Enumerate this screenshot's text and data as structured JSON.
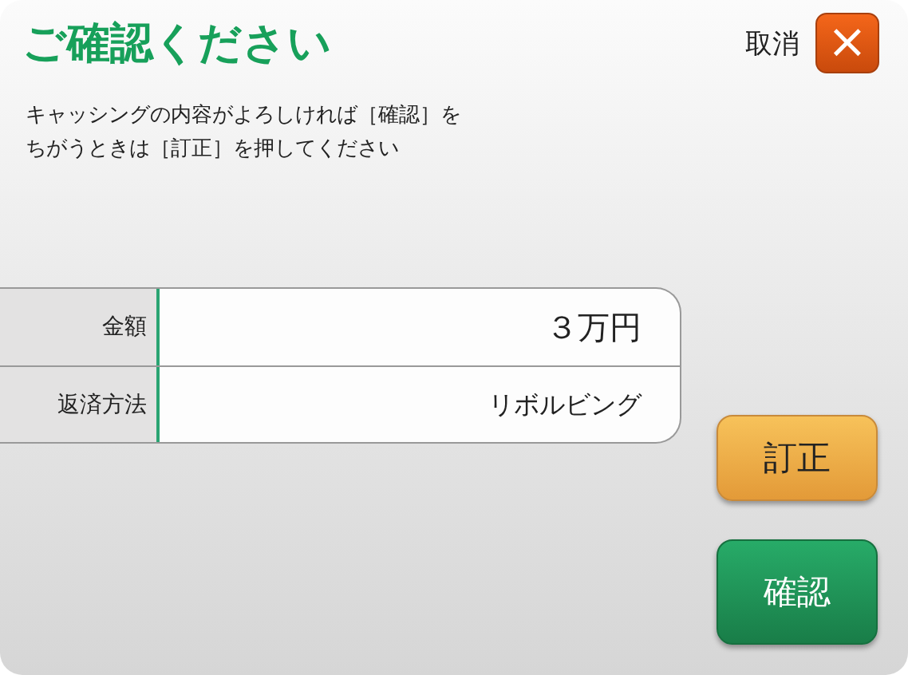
{
  "title": "ご確認ください",
  "cancel": {
    "label": "取消",
    "icon": "×"
  },
  "message": [
    "キャッシングの内容がよろしければ［確認］を",
    "ちがうときは［訂正］を押してください"
  ],
  "rows": [
    {
      "label": "金額",
      "value": "３万円"
    },
    {
      "label": "返済方法",
      "value": "リボルビング"
    }
  ],
  "buttons": [
    {
      "label": "訂正",
      "kind": "correct"
    },
    {
      "label": "確認",
      "kind": "confirm"
    }
  ]
}
